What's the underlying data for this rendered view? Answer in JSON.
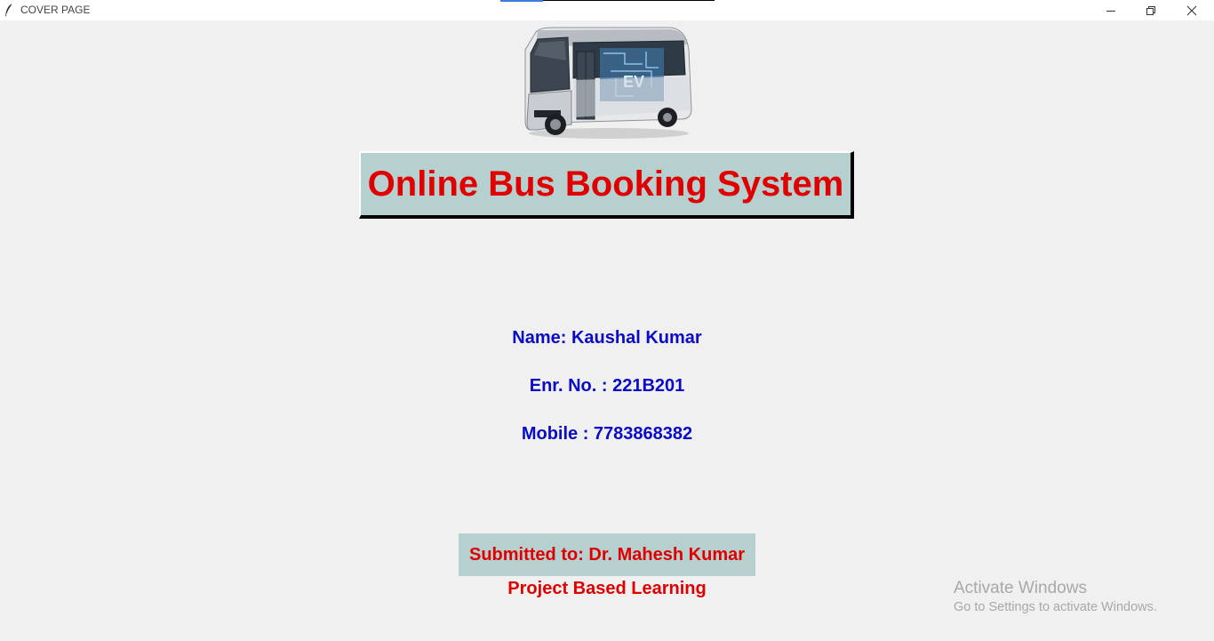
{
  "window": {
    "title": "COVER PAGE",
    "app_icon": "feather-icon",
    "controls": [
      "minimize-icon",
      "restore-icon",
      "close-icon"
    ]
  },
  "header": {
    "image": "electric-bus-image",
    "title": "Online Bus Booking System"
  },
  "student": {
    "name": "Name: Kaushal Kumar",
    "enrollment": "Enr. No. : 221B201",
    "mobile": "Mobile : 7783868382"
  },
  "footer": {
    "submitted_to": "Submitted to: Dr. Mahesh Kumar",
    "project_type": "Project Based Learning"
  },
  "watermark": {
    "title": "Activate Windows",
    "subtitle": "Go to Settings to activate Windows."
  },
  "colors": {
    "background": "#f0f0f0",
    "box": "#b6d0d0",
    "red_text": "#e00000",
    "blue_text": "#0a0ac8"
  }
}
